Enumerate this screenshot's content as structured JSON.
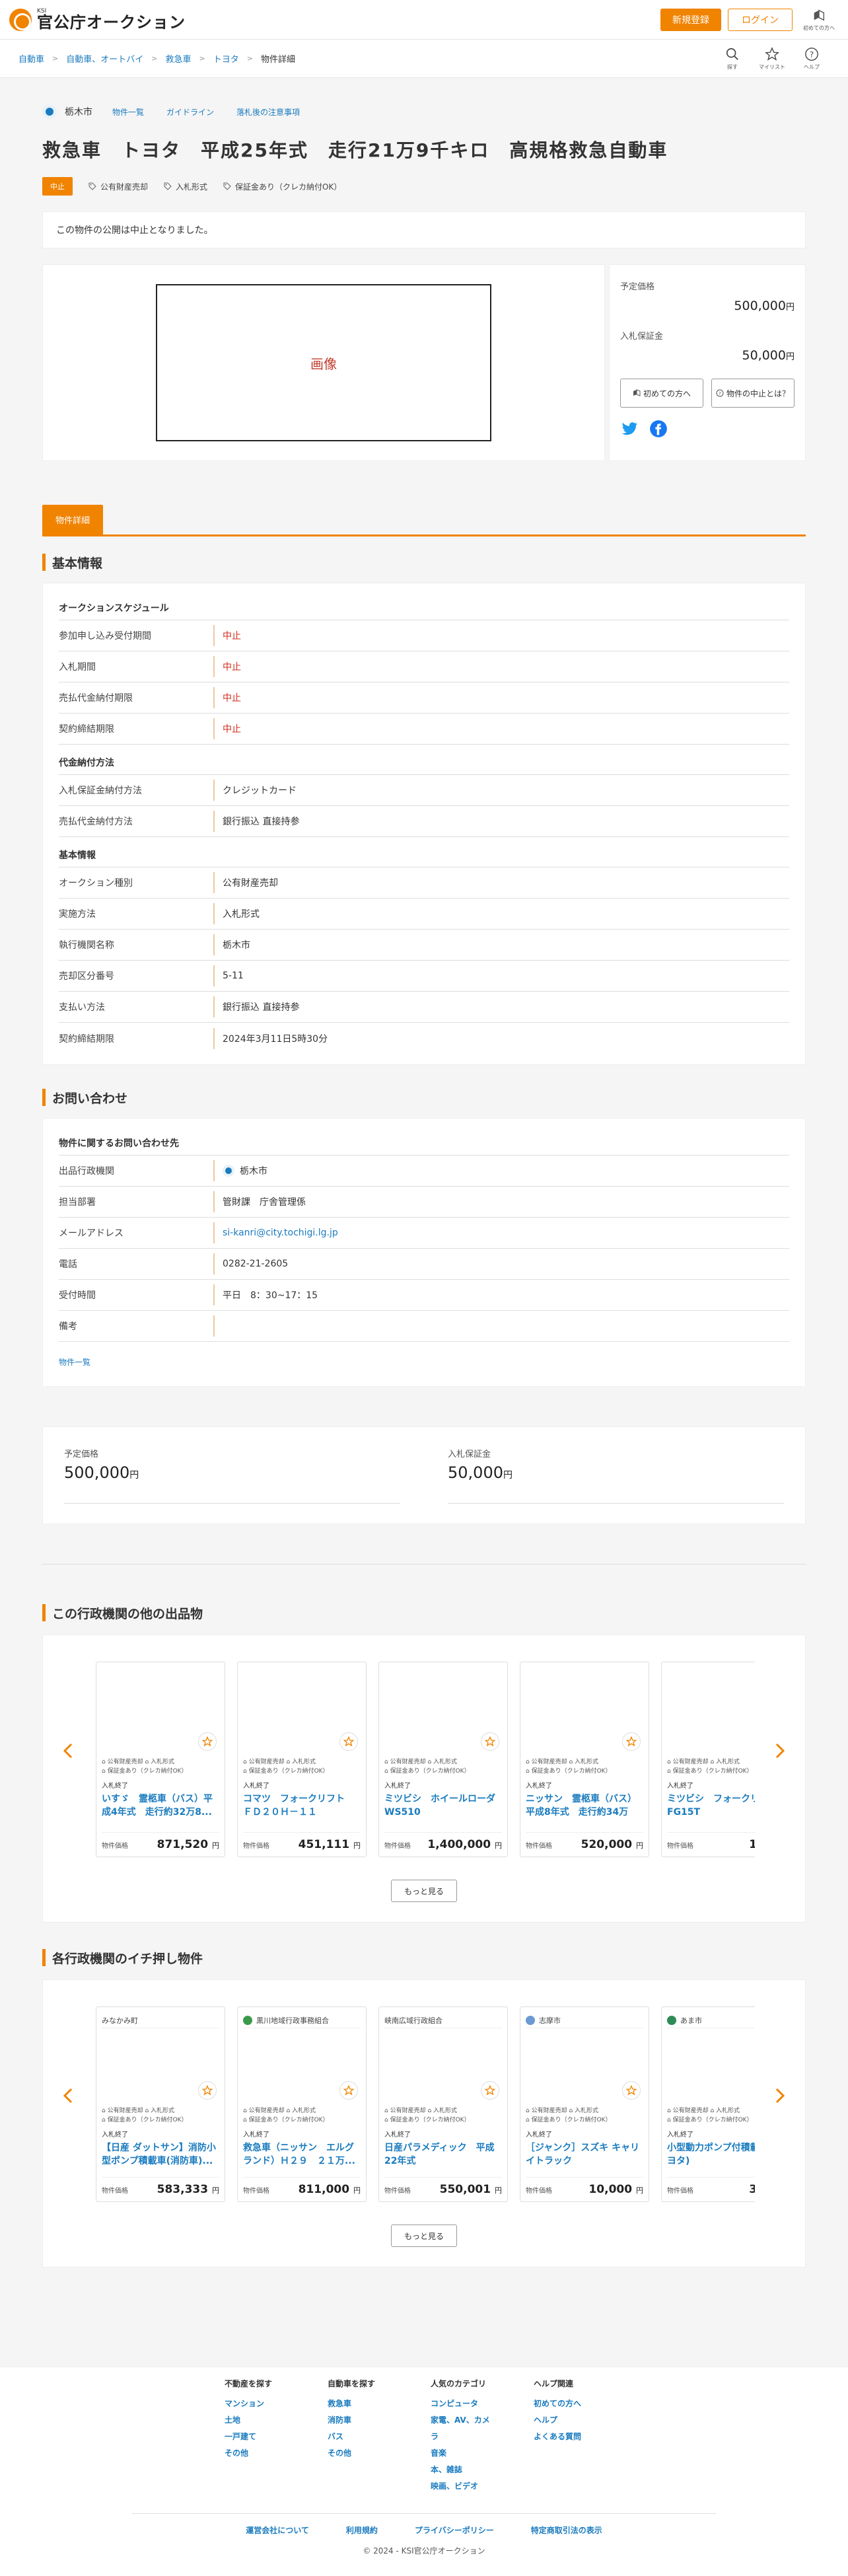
{
  "header": {
    "logo_sub": "KSI",
    "logo_main": "官公庁オークション",
    "register_label": "新規登録",
    "login_label": "ログイン",
    "beginner_label": "初めての方へ"
  },
  "breadcrumb": {
    "items": [
      "自動車",
      "自動車、オートバイ",
      "救急車",
      "トヨタ"
    ],
    "current": "物件詳細"
  },
  "bc_icons": {
    "search": "探す",
    "mylist": "マイリスト",
    "help": "ヘルプ"
  },
  "org": {
    "name": "栃木市",
    "links": [
      "物件一覧",
      "ガイドライン",
      "落札後の注意事項"
    ]
  },
  "title": "救急車　トヨタ　平成25年式　走行21万9千キロ　高規格救急自動車",
  "tags": {
    "status": "中止",
    "t1": "公有財産売却",
    "t2": "入札形式",
    "t3": "保証金あり（クレカ納付OK）"
  },
  "notice": "この物件の公開は中止となりました。",
  "media": {
    "placeholder": "画像"
  },
  "price_box": {
    "estimate_label": "予定価格",
    "estimate_value": "500,000",
    "deposit_label": "入札保証金",
    "deposit_value": "50,000",
    "yen": "円",
    "btn_beginner": "初めての方へ",
    "btn_cancel": "物件の中止とは？"
  },
  "tab_label": "物件詳細",
  "basic": {
    "heading": "基本情報",
    "schedule_h": "オークションスケジュール",
    "schedule": [
      {
        "k": "参加申し込み受付期間",
        "v": "中止"
      },
      {
        "k": "入札期間",
        "v": "中止"
      },
      {
        "k": "売払代金納付期限",
        "v": "中止"
      },
      {
        "k": "契約締結期限",
        "v": "中止"
      }
    ],
    "payment_h": "代金納付方法",
    "payment": [
      {
        "k": "入札保証金納付方法",
        "v": "クレジットカード"
      },
      {
        "k": "売払代金納付方法",
        "v": "銀行振込 直接持参"
      }
    ],
    "info_h": "基本情報",
    "info": [
      {
        "k": "オークション種別",
        "v": "公有財産売却"
      },
      {
        "k": "実施方法",
        "v": "入札形式"
      },
      {
        "k": "執行機関名称",
        "v": "栃木市"
      },
      {
        "k": "売却区分番号",
        "v": "5-11"
      },
      {
        "k": "支払い方法",
        "v": "銀行振込 直接持参"
      },
      {
        "k": "契約締結期限",
        "v": "2024年3月11日5時30分"
      }
    ]
  },
  "contact": {
    "heading": "お問い合わせ",
    "sub_h": "物件に関するお問い合わせ先",
    "rows": [
      {
        "k": "出品行政機関",
        "v": "栃木市"
      },
      {
        "k": "担当部署",
        "v": "管財課　庁舎管理係"
      },
      {
        "k": "メールアドレス",
        "v": "si-kanri@city.tochigi.lg.jp"
      },
      {
        "k": "電話",
        "v": "0282-21-2605"
      },
      {
        "k": "受付時間",
        "v": "平日　8：30~17：15"
      },
      {
        "k": "備考",
        "v": ""
      }
    ],
    "link": "物件一覧"
  },
  "summary": {
    "estimate_label": "予定価格",
    "estimate_value": "500,000",
    "deposit_label": "入札保証金",
    "deposit_value": "50,000",
    "yen": "円"
  },
  "other": {
    "heading": "この行政機関の他の出品物",
    "more": "もっと見る",
    "cards": [
      {
        "status": "入札終了",
        "name": "いすゞ　霊柩車（バス）平成4年式　走行約32万8...",
        "price_label": "物件価格",
        "price": "871,520",
        "tag1": "公有財産売却",
        "tag2": "入札形式",
        "tag3": "保証金あり（クレカ納付OK）"
      },
      {
        "status": "入札終了",
        "name": "コマツ　フォークリフト　ＦＤ２０Ｈ－１１",
        "price_label": "物件価格",
        "price": "451,111",
        "tag1": "公有財産売却",
        "tag2": "入札形式",
        "tag3": "保証金あり（クレカ納付OK）"
      },
      {
        "status": "入札終了",
        "name": "ミツビシ　ホイールローダ WS510",
        "price_label": "物件価格",
        "price": "1,400,000",
        "tag1": "公有財産売却",
        "tag2": "入札形式",
        "tag3": "保証金あり（クレカ納付OK）"
      },
      {
        "status": "入札終了",
        "name": "ニッサン　霊柩車（バス）平成8年式　走行約34万3...",
        "price_label": "物件価格",
        "price": "520,000",
        "tag1": "公有財産売却",
        "tag2": "入札形式",
        "tag3": "保証金あり（クレカ納付OK）"
      },
      {
        "status": "入札終了",
        "name": "ミツビシ　フォークリフト FG15T",
        "price_label": "物件価格",
        "price": "151,1",
        "tag1": "公有財産売却",
        "tag2": "入札形式",
        "tag3": "保証金あり（クレカ納付OK）"
      }
    ]
  },
  "pickup": {
    "heading": "各行政機関のイチ押し物件",
    "more": "もっと見る",
    "cards": [
      {
        "org": "みなかみ町",
        "status": "入札終了",
        "name": "【日産 ダットサン】消防小型ポンプ積載車(消防車)...",
        "price_label": "物件価格",
        "price": "583,333",
        "tag1": "公有財産売却",
        "tag2": "入札形式",
        "tag3": "保証金あり（クレカ納付OK）"
      },
      {
        "org": "黒川地域行政事務組合",
        "status": "入札終了",
        "name": "救急車（ニッサン　エルグランド）Ｈ２９　２１万...",
        "price_label": "物件価格",
        "price": "811,000",
        "tag1": "公有財産売却",
        "tag2": "入札形式",
        "tag3": "保証金あり（クレカ納付OK）"
      },
      {
        "org": "峡南広域行政組合",
        "status": "入札終了",
        "name": "日産パラメディック　平成22年式",
        "price_label": "物件価格",
        "price": "550,001",
        "tag1": "公有財産売却",
        "tag2": "入札形式",
        "tag3": "保証金あり（クレカ納付OK）"
      },
      {
        "org": "志摩市",
        "status": "入札終了",
        "name": "［ジャンク］スズキ キャリイトラック",
        "price_label": "物件価格",
        "price": "10,000",
        "tag1": "公有財産売却",
        "tag2": "入札形式",
        "tag3": "保証金あり（クレカ納付OK）"
      },
      {
        "org": "あま市",
        "status": "入札終了",
        "name": "小型動力ポンプ付積載車(トヨタ)",
        "price_label": "物件価格",
        "price": "364,1",
        "tag1": "公有財産売却",
        "tag2": "入札形式",
        "tag3": "保証金あり（クレカ納付OK）"
      }
    ]
  },
  "footer": {
    "cols": [
      {
        "h": "不動産を探す",
        "links": [
          "マンション",
          "土地",
          "一戸建て",
          "その他"
        ]
      },
      {
        "h": "自動車を探す",
        "links": [
          "救急車",
          "消防車",
          "バス",
          "その他"
        ]
      },
      {
        "h": "人気のカテゴリ",
        "links": [
          "コンピュータ",
          "家電、AV、カメラ",
          "音楽",
          "本、雑誌",
          "映画、ビデオ"
        ]
      },
      {
        "h": "ヘルプ関連",
        "links": [
          "初めての方へ",
          "ヘルプ",
          "よくある質問"
        ]
      }
    ],
    "bottom_links": [
      "運営会社について",
      "利用規約",
      "プライバシーポリシー",
      "特定商取引法の表示"
    ],
    "copyright": "© 2024 - KSI官公庁オークション"
  },
  "icons": [
    "search-icon",
    "star-icon",
    "help-icon",
    "tag-icon",
    "twitter-icon",
    "facebook-icon",
    "chevron-left-icon",
    "chevron-right-icon",
    "beginner-icon"
  ]
}
